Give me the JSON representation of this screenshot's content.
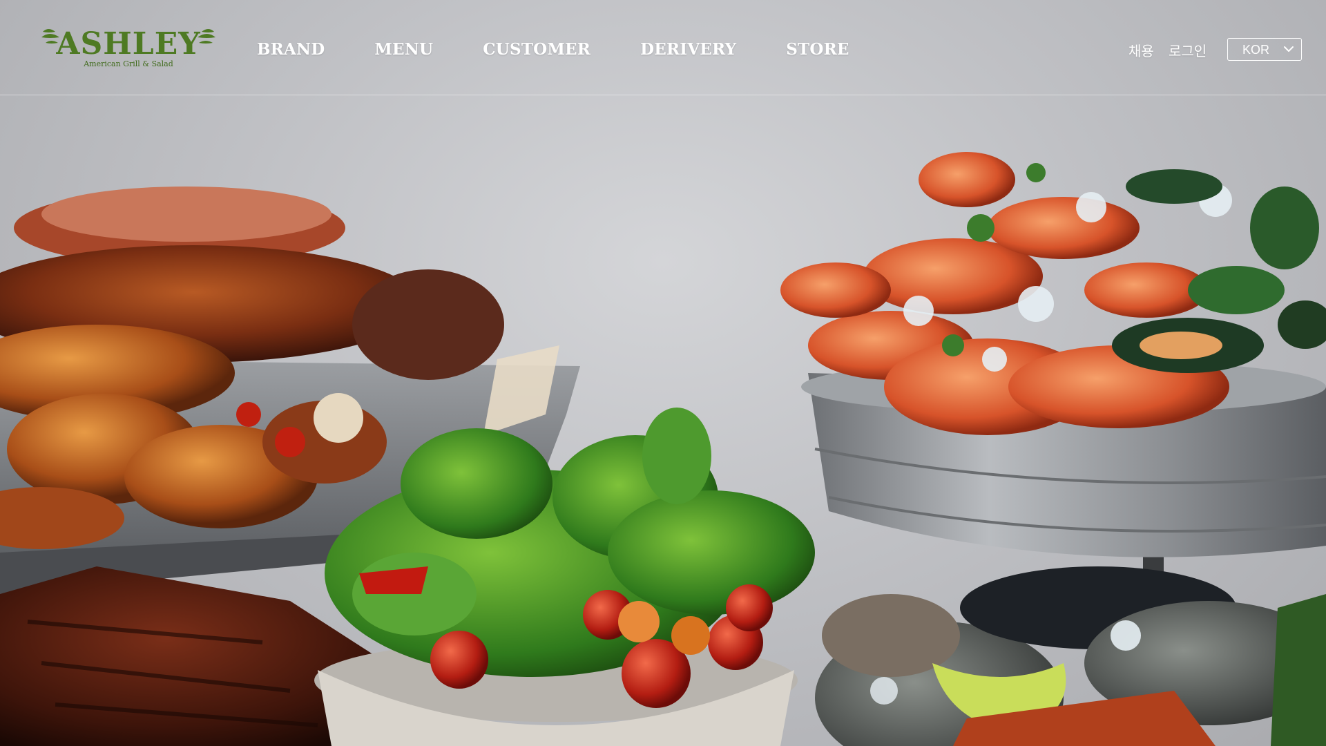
{
  "brand": {
    "logo_name": "ASHLEY",
    "logo_tagline": "American Grill & Salad",
    "logo_color": "#4e7a23"
  },
  "nav": {
    "items": [
      {
        "label": "BRAND"
      },
      {
        "label": "MENU"
      },
      {
        "label": "CUSTOMER"
      },
      {
        "label": "DERIVERY"
      },
      {
        "label": "STORE"
      }
    ]
  },
  "utility": {
    "recruit_label": "채용",
    "login_label": "로그인"
  },
  "language": {
    "selected": "KOR",
    "icon": "chevron-down-icon"
  },
  "hero": {
    "image": "food-spread-photo"
  }
}
